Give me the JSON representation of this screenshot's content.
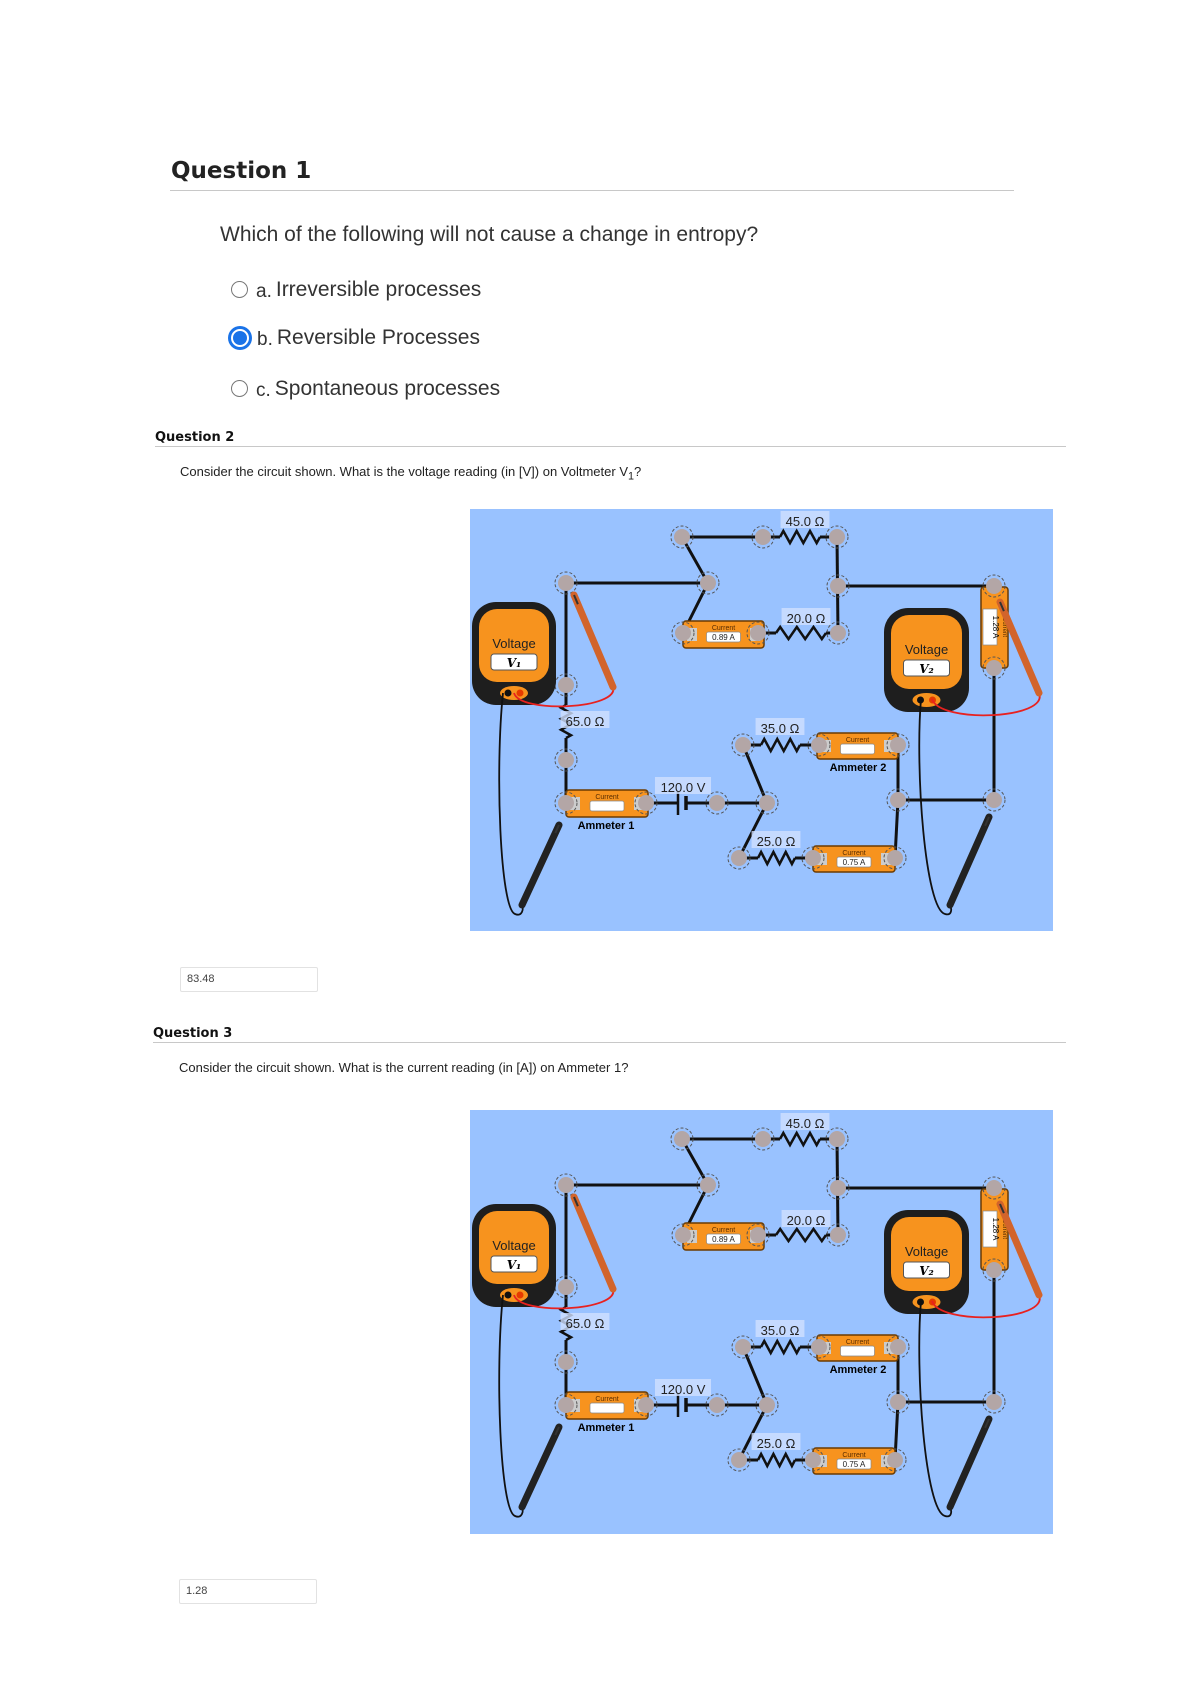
{
  "question1": {
    "title": "Question 1",
    "text": "Which of the following will not cause a change in entropy?",
    "options": [
      {
        "letter": "a.",
        "label": "Irreversible processes",
        "selected": false
      },
      {
        "letter": "b.",
        "label": "Reversible Processes",
        "selected": true
      },
      {
        "letter": "c.",
        "label": "Spontaneous processes",
        "selected": false
      }
    ]
  },
  "question2": {
    "title": "Question 2",
    "text_prefix": "Consider the circuit shown. What is the voltage reading (in [V]) on Voltmeter V",
    "text_sub": "1",
    "text_suffix": "?",
    "answer": "83.48"
  },
  "question3": {
    "title": "Question 3",
    "text": "Consider the circuit shown. What is the current reading (in [A]) on Ammeter 1?",
    "answer": "1.28"
  },
  "circuit": {
    "resistors": [
      "45.0 Ω",
      "20.0 Ω",
      "65.0 Ω",
      "35.0 Ω",
      "25.0 Ω"
    ],
    "battery": "120.0 V",
    "ammeter_caption": "Current",
    "ammeter_readings": {
      "top": "0.89 A",
      "right": "1.28 A",
      "bottom": "0.75 A",
      "ammeter1": "",
      "ammeter2": ""
    },
    "ammeter_labels": [
      "Ammeter 1",
      "Ammeter 2"
    ],
    "voltmeter_caption": "Voltage",
    "voltmeter_labels": [
      "V₁",
      "V₂"
    ],
    "colors": {
      "background": "#99c2ff",
      "meter": "#f7931e",
      "node": "#b3a6a6",
      "red_lead": "#e8211f",
      "probe_red": "#d2642b"
    }
  }
}
